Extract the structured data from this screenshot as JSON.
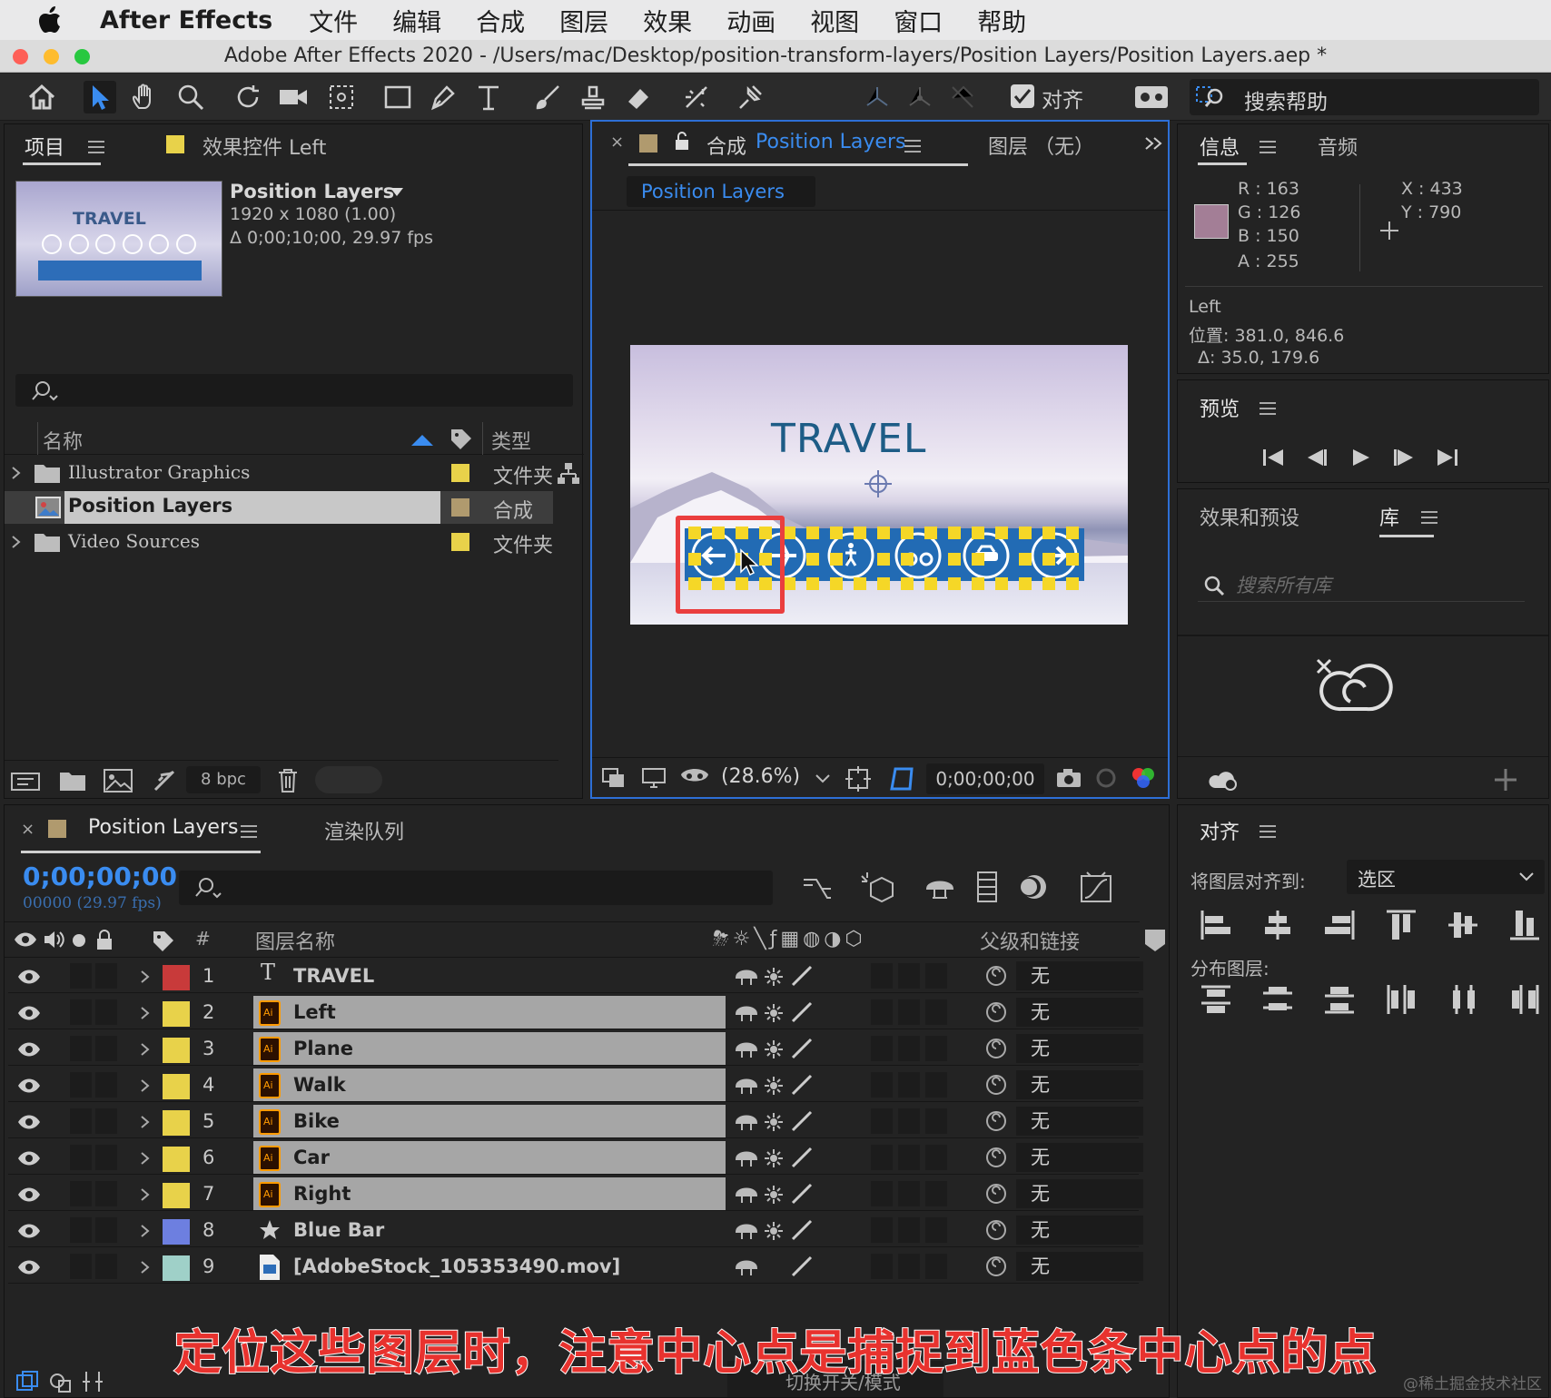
{
  "menubar": {
    "app": "After Effects",
    "items": [
      "文件",
      "编辑",
      "合成",
      "图层",
      "效果",
      "动画",
      "视图",
      "窗口",
      "帮助"
    ]
  },
  "window": {
    "title": "Adobe After Effects 2020 - /Users/mac/Desktop/position-transform-layers/Position Layers/Position Layers.aep *"
  },
  "toolbar": {
    "align_label": "对齐",
    "search_help": "搜索帮助"
  },
  "project": {
    "tab": "项目",
    "effects_tab": "效果控件 Left",
    "comp_name": "Position Layers",
    "comp_res": "1920 x 1080 (1.00)",
    "comp_dur": "Δ 0;00;10;00, 29.97 fps",
    "thumb_text": "TRAVEL",
    "col_name": "名称",
    "col_type": "类型",
    "items": [
      {
        "name": "Illustrator Graphics",
        "type": "文件夹",
        "color": "#e8d24a"
      },
      {
        "name": "Position Layers",
        "type": "合成",
        "color": "#b09a6e"
      },
      {
        "name": "Video Sources",
        "type": "文件夹",
        "color": "#e8d24a"
      }
    ],
    "bpc": "8 bpc"
  },
  "composition": {
    "tab_prefix": "合成",
    "tab_name": "Position Layers",
    "layer_tab": "图层 （无）",
    "breadcrumb": "Position Layers",
    "canvas_title": "TRAVEL",
    "zoom": "(28.6%)",
    "timecode": "0;00;00;00"
  },
  "info": {
    "tab": "信息",
    "audio_tab": "音频",
    "r": "R :  163",
    "g": "G :  126",
    "b": "B :  150",
    "a": "A :  255",
    "x": "X : 433",
    "y": "Y : 790",
    "layer": "Left",
    "position": "位置: 381.0, 846.6",
    "delta": "Δ: 35.0, 179.6",
    "swatch": "#a37e96"
  },
  "preview": {
    "tab": "预览"
  },
  "effects": {
    "tab": "效果和预设",
    "lib_tab": "库",
    "search_placeholder": "搜索所有库"
  },
  "align": {
    "tab": "对齐",
    "align_to_label": "将图层对齐到:",
    "align_to_value": "选区",
    "distribute_label": "分布图层:"
  },
  "timeline": {
    "tab": "Position Layers",
    "render_tab": "渲染队列",
    "timecode": "0;00;00;00",
    "frames": "00000 (29.97 fps)",
    "col_layer_name": "图层名称",
    "col_parent": "父级和链接",
    "col_num": "#",
    "footer": "切换开关/模式",
    "layers": [
      {
        "num": "1",
        "name": "TRAVEL",
        "type": "T",
        "color": "#c83a3a",
        "parent": "无"
      },
      {
        "num": "2",
        "name": "Left",
        "type": "Ai",
        "color": "#e8d24a",
        "parent": "无"
      },
      {
        "num": "3",
        "name": "Plane",
        "type": "Ai",
        "color": "#e8d24a",
        "parent": "无"
      },
      {
        "num": "4",
        "name": "Walk",
        "type": "Ai",
        "color": "#e8d24a",
        "parent": "无"
      },
      {
        "num": "5",
        "name": "Bike",
        "type": "Ai",
        "color": "#e8d24a",
        "parent": "无"
      },
      {
        "num": "6",
        "name": "Car",
        "type": "Ai",
        "color": "#e8d24a",
        "parent": "无"
      },
      {
        "num": "7",
        "name": "Right",
        "type": "Ai",
        "color": "#e8d24a",
        "parent": "无"
      },
      {
        "num": "8",
        "name": "Blue Bar",
        "type": "star",
        "color": "#6d7fe0",
        "parent": "无"
      },
      {
        "num": "9",
        "name": "[AdobeStock_105353490.mov]",
        "type": "mov",
        "color": "#9fd0c8",
        "parent": "无"
      }
    ]
  },
  "caption": "定位这些图层时，注意中心点是捕捉到蓝色条中心点的点",
  "watermark": "@稀土掘金技术社区"
}
